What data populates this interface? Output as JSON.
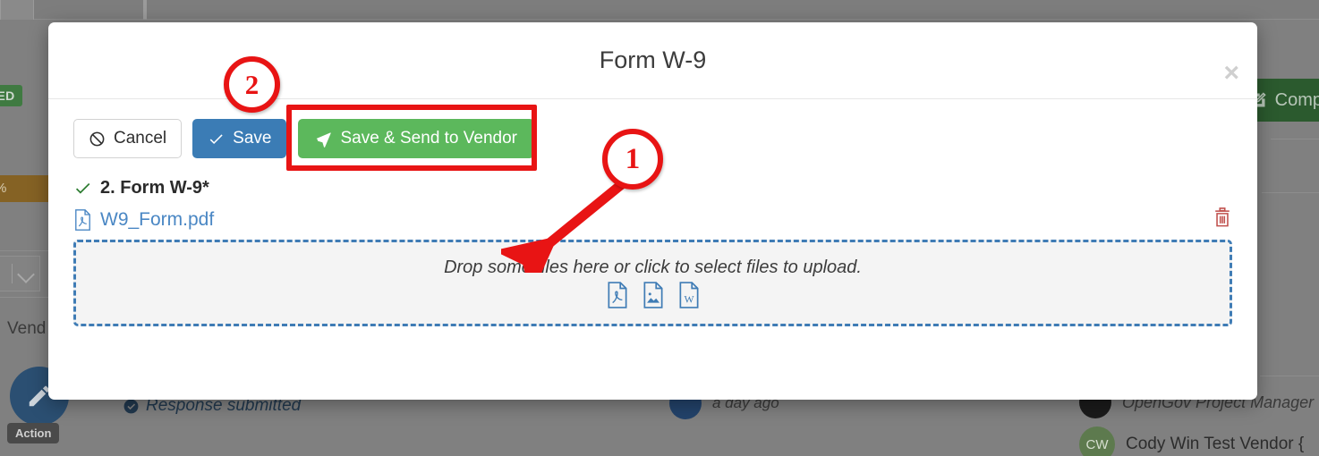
{
  "modal": {
    "title": "Form W-9",
    "close_label": "×",
    "buttons": {
      "cancel": "Cancel",
      "save": "Save",
      "save_send": "Save & Send to Vendor"
    },
    "field": {
      "label": "2. Form W-9*",
      "check_icon": "check-icon"
    },
    "attachment": {
      "filename": "W9_Form.pdf",
      "file_icon": "pdf-file-icon",
      "delete_icon": "trash-icon"
    },
    "dropzone": {
      "text": "Drop some files here or click to select files to upload.",
      "icons": [
        "pdf-file-icon",
        "image-file-icon",
        "word-file-icon"
      ]
    }
  },
  "annotations": [
    {
      "id": "1",
      "label": "1"
    },
    {
      "id": "2",
      "label": "2"
    }
  ],
  "background": {
    "status_badge": "SED",
    "progress_label": "%",
    "vendor_label": "Vend",
    "complete_button": "Comp",
    "action_tooltip": "Action",
    "response_status": "Response submitted",
    "time_ago": "a day ago",
    "project_manager": "OpenGov Project Manager",
    "vendor_row": "Cody Win Test Vendor {",
    "vendor_initials": "CW"
  },
  "colors": {
    "primary_blue": "#3b7cb5",
    "success_green": "#5cb85c",
    "annotation_red": "#e81414",
    "dropzone_border": "#3f7cb5",
    "link_blue": "#4a87c4",
    "trash_red": "#c0504d"
  }
}
